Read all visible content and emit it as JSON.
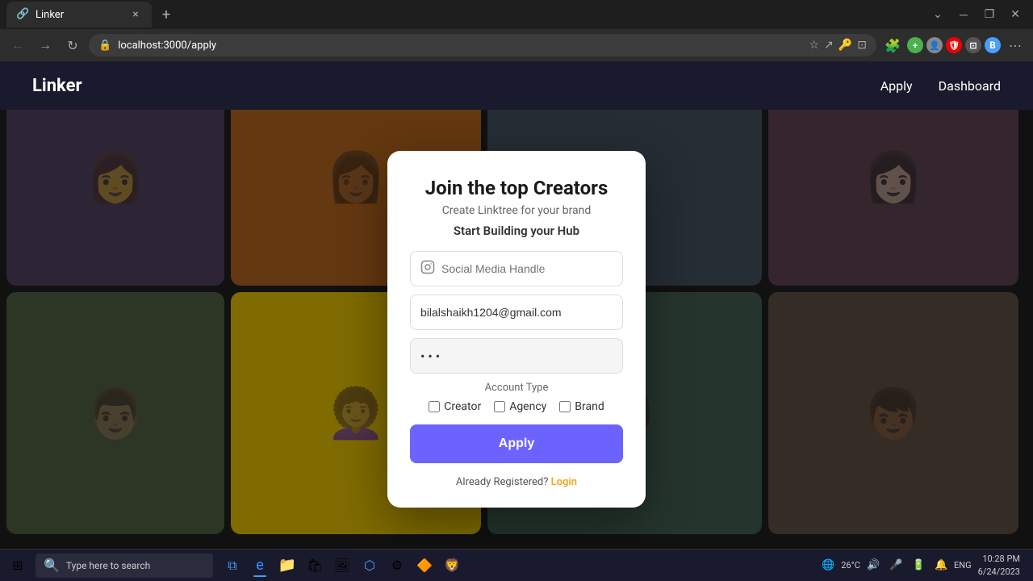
{
  "browser": {
    "tab_title": "Linker",
    "tab_favicon": "🔗",
    "url": "localhost:3000/apply",
    "close_tab": "×",
    "new_tab": "+"
  },
  "navbar": {
    "brand": "Linker",
    "links": [
      "Apply",
      "Dashboard"
    ]
  },
  "modal": {
    "title": "Join the top Creators",
    "subtitle": "Create Linktree for your brand",
    "section_title": "Start Building your Hub",
    "social_handle_placeholder": "Social Media Handle",
    "email_value": "bilalshaikh1204@gmail.com",
    "password_dots": "•••",
    "account_type_label": "Account Type",
    "account_options": [
      {
        "label": "Creator",
        "checked": false
      },
      {
        "label": "Agency",
        "checked": false
      },
      {
        "label": "Brand",
        "checked": false
      }
    ],
    "apply_btn": "Apply",
    "already_registered_text": "Already Registered?",
    "login_link": "Login"
  },
  "taskbar": {
    "search_placeholder": "Type here to search",
    "time": "10:28 PM",
    "date": "6/24/2023",
    "temp": "26°C",
    "lang": "ENG"
  },
  "icons": {
    "start": "⊞",
    "search": "🔍",
    "instagram": "⊙",
    "taskview": "□",
    "edge": "e",
    "explorer": "📁",
    "store": "🏪"
  }
}
